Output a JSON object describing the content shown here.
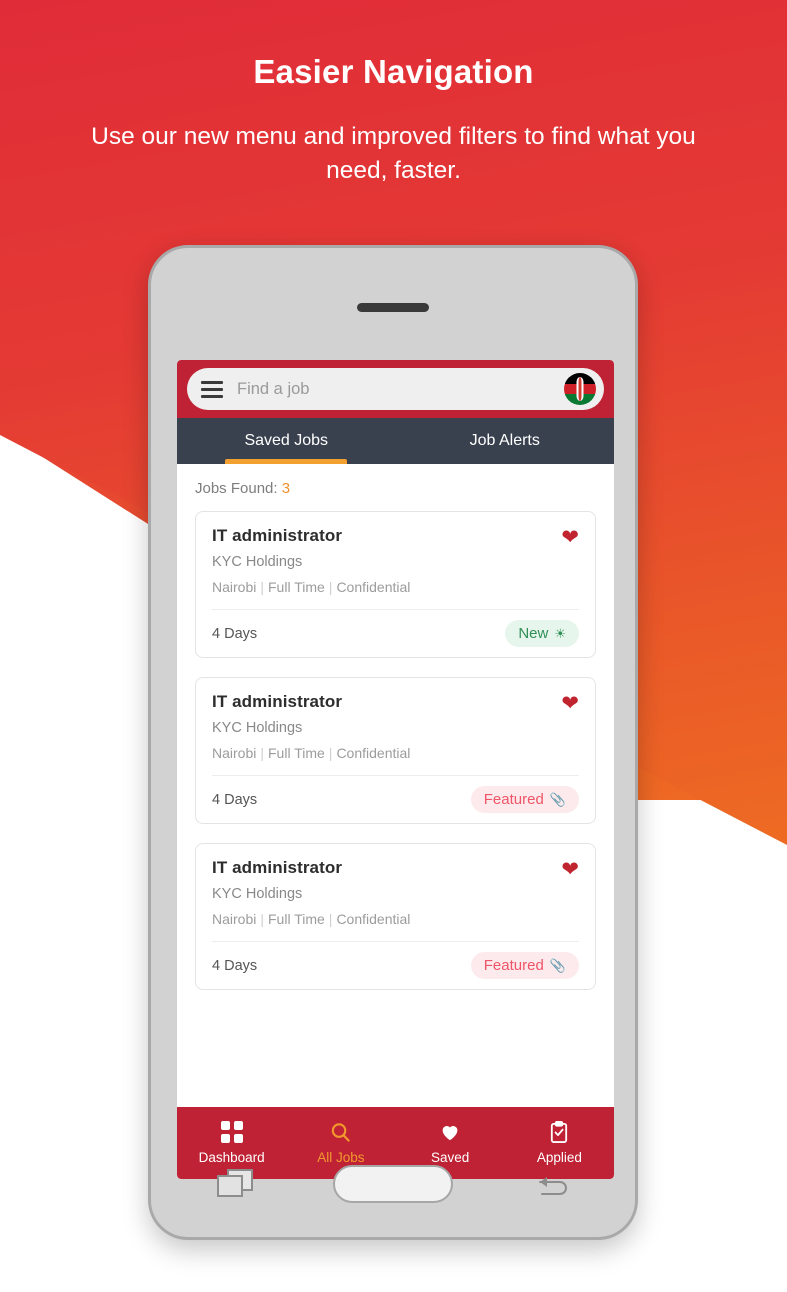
{
  "promo": {
    "headline": "Easier Navigation",
    "subhead": "Use our new menu and improved filters to find what you need, faster."
  },
  "colors": {
    "brand_red": "#bf2234",
    "accent_orange": "#f2992d",
    "tab_bar": "#39414f",
    "badge_new_bg": "#e7f6ec",
    "badge_new_text": "#2f8f57",
    "badge_featured_bg": "#fdeaec",
    "badge_featured_text": "#ef5568",
    "heart_red": "#c0252f"
  },
  "app": {
    "search": {
      "placeholder": "Find a job",
      "menu_icon": "hamburger-icon",
      "flag_icon": "kenya-flag-icon"
    },
    "tabs": [
      {
        "label": "Saved Jobs",
        "active": true
      },
      {
        "label": "Job Alerts",
        "active": false
      }
    ],
    "results": {
      "label": "Jobs Found:",
      "count": "3"
    },
    "jobs": [
      {
        "title": "IT administrator",
        "company": "KYC Holdings",
        "location": "Nairobi",
        "employment_type": "Full Time",
        "salary": "Confidential",
        "posted": "4 Days",
        "badge": {
          "label": "New",
          "icon": "sparkle-icon",
          "style": "new"
        },
        "saved_icon": "heart-filled-icon"
      },
      {
        "title": "IT administrator",
        "company": "KYC Holdings",
        "location": "Nairobi",
        "employment_type": "Full Time",
        "salary": "Confidential",
        "posted": "4 Days",
        "badge": {
          "label": "Featured",
          "icon": "paperclip-icon",
          "style": "featured"
        },
        "saved_icon": "heart-filled-icon"
      },
      {
        "title": "IT administrator",
        "company": "KYC Holdings",
        "location": "Nairobi",
        "employment_type": "Full Time",
        "salary": "Confidential",
        "posted": "4 Days",
        "badge": {
          "label": "Featured",
          "icon": "paperclip-icon",
          "style": "featured"
        },
        "saved_icon": "heart-filled-icon"
      }
    ],
    "bottom_nav": [
      {
        "label": "Dashboard",
        "icon": "grid-icon",
        "active": false
      },
      {
        "label": "All Jobs",
        "icon": "search-icon",
        "active": true
      },
      {
        "label": "Saved",
        "icon": "heart-icon",
        "active": false
      },
      {
        "label": "Applied",
        "icon": "clipboard-check-icon",
        "active": false
      }
    ]
  },
  "device": {
    "nav_buttons": [
      {
        "name": "recents-button"
      },
      {
        "name": "home-button"
      },
      {
        "name": "back-button"
      }
    ]
  }
}
